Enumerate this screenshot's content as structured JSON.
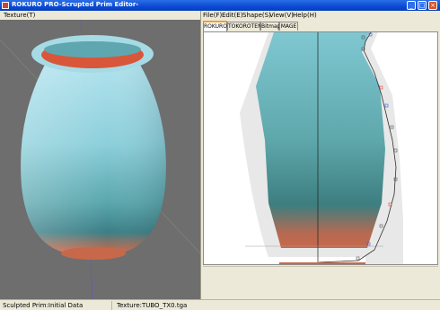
{
  "window": {
    "title": "ROKURO PRO-Scrupted Prim Editor-"
  },
  "left_menu": {
    "texture": "Texture(T)"
  },
  "right_menu": [
    "File(F)",
    "Edit(E)",
    "Shape(S)",
    "View(V)",
    "Help(H)"
  ],
  "tabs": [
    "ROKURO",
    "TOKOROTEN",
    "Bitmap",
    "MAGE"
  ],
  "active_tab": "ROKURO",
  "status": {
    "left": "Sculpted Prim:Initial Data",
    "right": "Texture:TUBO_TX0.tga"
  },
  "colors": {
    "titlebar": "#0a4ad6",
    "vase_top": "#aee0ec",
    "vase_bottom": "#3b7f86",
    "terracotta": "#c8684a",
    "viewport_bg": "#6e6e6e"
  },
  "icons": [
    "minimize-icon",
    "maximize-icon",
    "close-icon",
    "app-icon"
  ]
}
